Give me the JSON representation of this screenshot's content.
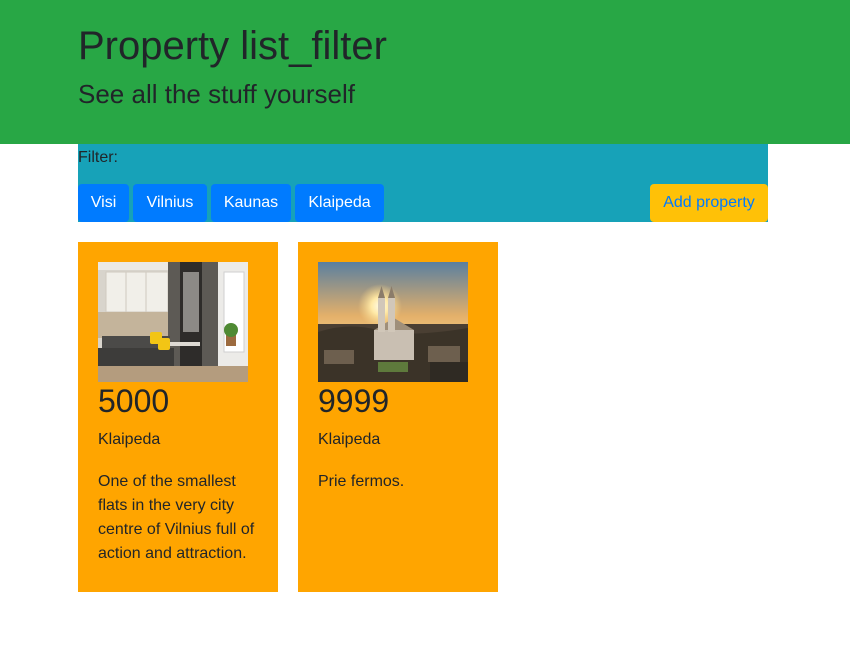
{
  "header": {
    "title": "Property list_filter",
    "subtitle": "See all the stuff yourself"
  },
  "filter": {
    "label": "Filter:",
    "buttons": [
      "Visi",
      "Vilnius",
      "Kaunas",
      "Klaipeda"
    ],
    "add_label": "Add property"
  },
  "properties": [
    {
      "price": "5000",
      "city": "Klaipeda",
      "description": "One of the smallest flats in the very city centre of Vilnius full of action and attraction.",
      "image": "apartment-interior-photo"
    },
    {
      "price": "9999",
      "city": "Klaipeda",
      "description": "Prie fermos.",
      "image": "church-sunset-photo"
    }
  ],
  "colors": {
    "header_bg": "#28a745",
    "filter_bg": "#17a2b8",
    "card_bg": "#ffa500",
    "primary_button": "#007bff",
    "warning_button": "#ffc107"
  }
}
